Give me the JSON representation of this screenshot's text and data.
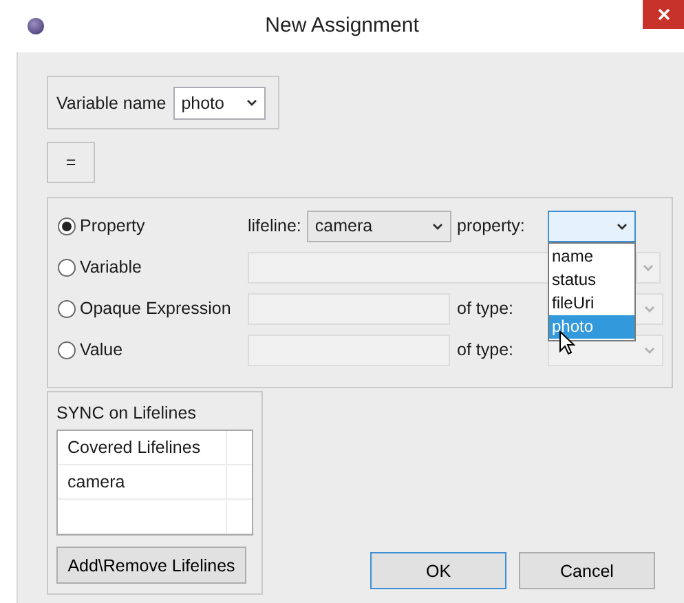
{
  "window": {
    "title": "New Assignment"
  },
  "variable_name": {
    "label": "Variable name",
    "value": "photo"
  },
  "operator_button": "=",
  "options": [
    {
      "kind": "property",
      "label": "Property",
      "selected": true,
      "lifeline_label": "lifeline:",
      "lifeline": "camera",
      "property_label": "property:",
      "property_expanded": true,
      "property_items": [
        {
          "label": "name",
          "selected": false
        },
        {
          "label": "status",
          "selected": false
        },
        {
          "label": "fileUri",
          "selected": false
        },
        {
          "label": "photo",
          "selected": true
        }
      ]
    },
    {
      "kind": "variable",
      "label": "Variable",
      "selected": false
    },
    {
      "kind": "typed",
      "label": "Opaque Expression",
      "selected": false,
      "type_label": "of type:"
    },
    {
      "kind": "typed",
      "label": "Value",
      "selected": false,
      "type_label": "of type:"
    }
  ],
  "sync": {
    "title": "SYNC on Lifelines",
    "columns": [
      "Covered Lifelines"
    ],
    "rows": [
      [
        "camera"
      ]
    ],
    "button": "Add\\Remove Lifelines"
  },
  "buttons": [
    {
      "label": "OK",
      "default": true
    },
    {
      "label": "Cancel",
      "default": false
    }
  ]
}
